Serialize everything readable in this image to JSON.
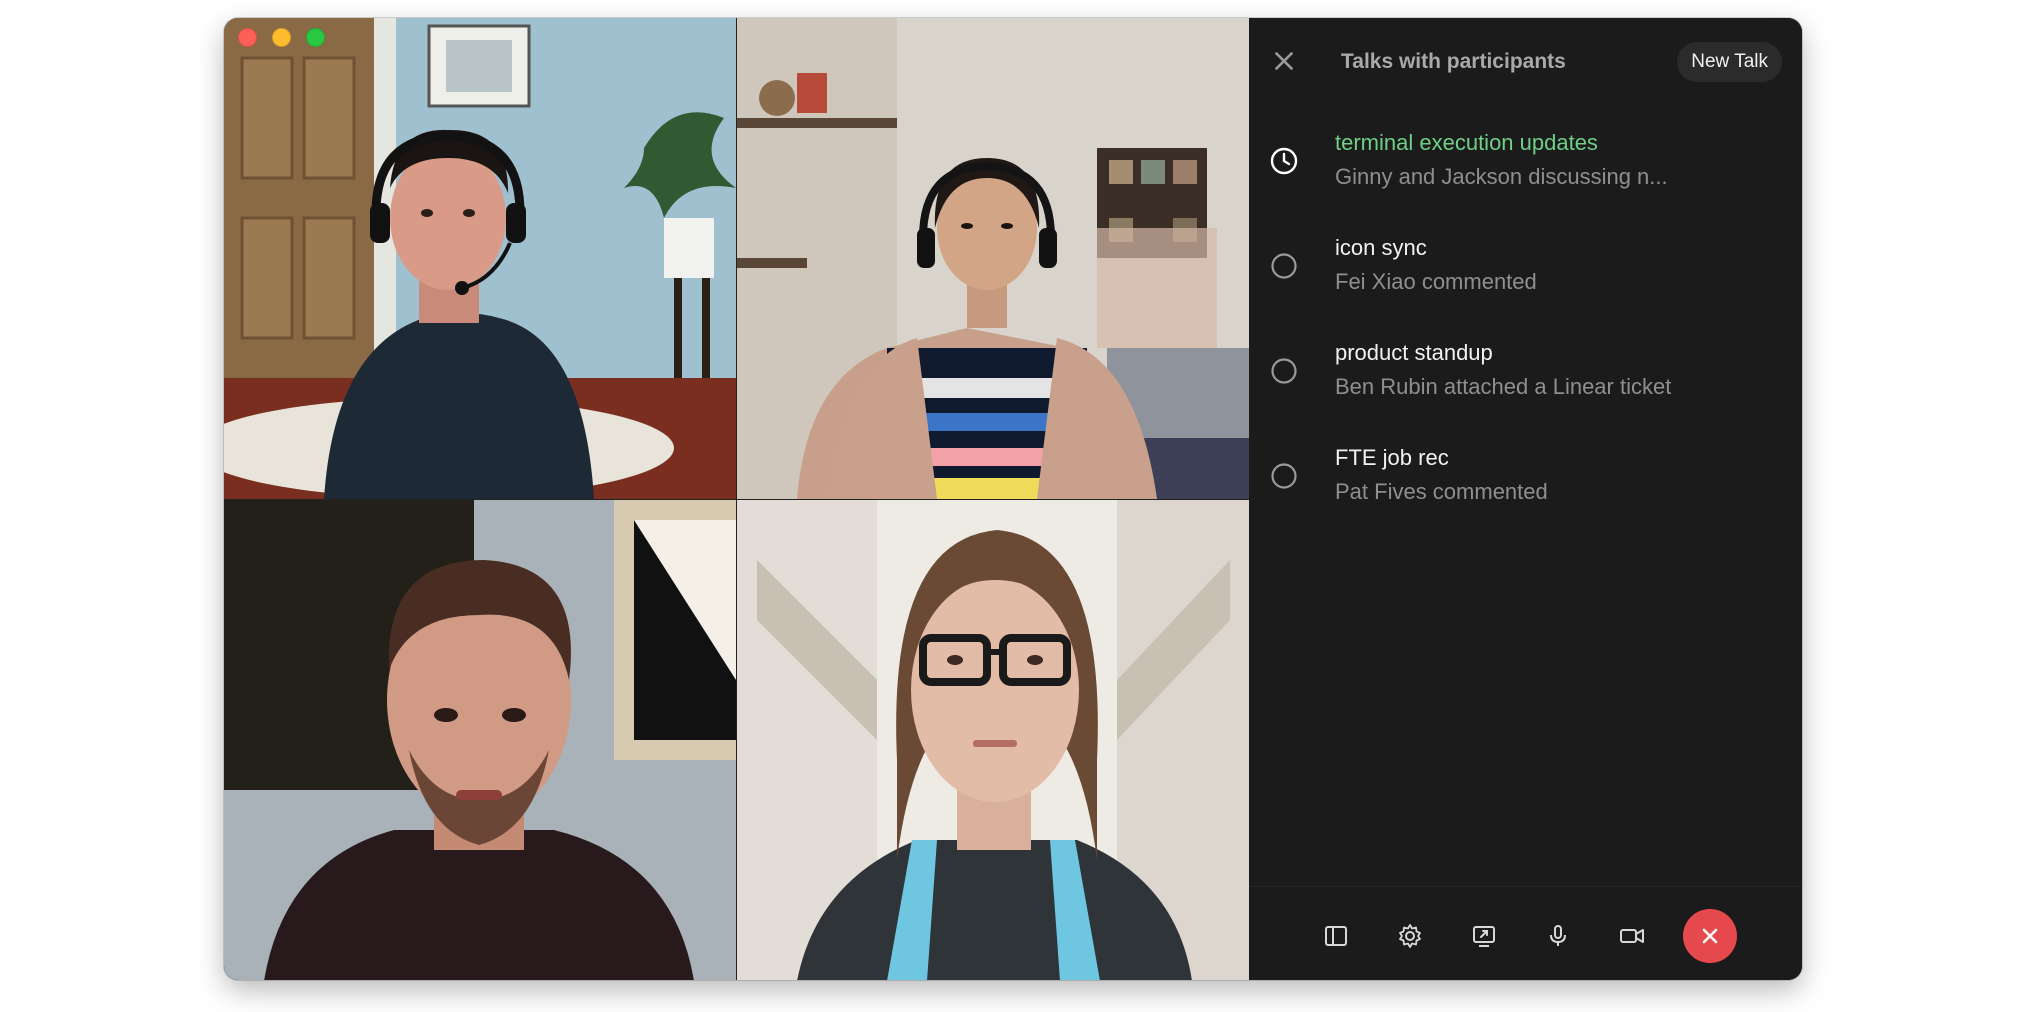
{
  "window": {
    "controls": [
      "close",
      "minimize",
      "zoom"
    ]
  },
  "video_tiles": [
    {
      "id": "tile-1",
      "icon": "participant-video"
    },
    {
      "id": "tile-2",
      "icon": "participant-video"
    },
    {
      "id": "tile-3",
      "icon": "participant-video"
    },
    {
      "id": "tile-4",
      "icon": "participant-video"
    }
  ],
  "panel": {
    "title": "Talks with participants",
    "new_talk_label": "New Talk",
    "close_icon": "close-icon",
    "talks": [
      {
        "title": "terminal execution updates",
        "subtitle": "Ginny and Jackson discussing n...",
        "icon": "clock-icon",
        "active": true
      },
      {
        "title": "icon sync",
        "subtitle": "Fei Xiao commented",
        "icon": "circle-icon",
        "active": false
      },
      {
        "title": "product standup",
        "subtitle": "Ben Rubin attached a Linear ticket",
        "icon": "circle-icon",
        "active": false
      },
      {
        "title": "FTE job rec",
        "subtitle": "Pat Fives commented",
        "icon": "circle-icon",
        "active": false
      }
    ]
  },
  "toolbar": {
    "buttons": [
      "sidebar-icon",
      "gear-icon",
      "screen-share-icon",
      "microphone-icon",
      "video-camera-icon",
      "end-call-icon"
    ]
  },
  "colors": {
    "accent_green": "#6fcf87",
    "end_call_red": "#e5484d",
    "panel_bg": "#1b1b1b"
  }
}
